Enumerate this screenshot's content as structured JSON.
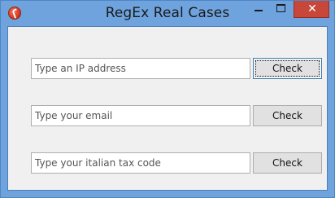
{
  "window": {
    "title": "RegEx Real Cases",
    "close_glyph": "✕"
  },
  "form": {
    "rows": [
      {
        "placeholder": "Type an IP address",
        "value": "",
        "button_label": "Check"
      },
      {
        "placeholder": "Type your email",
        "value": "",
        "button_label": "Check"
      },
      {
        "placeholder": "Type your italian tax code",
        "value": "",
        "button_label": "Check"
      }
    ]
  },
  "colors": {
    "title_bar": "#6fa3de",
    "close_button": "#c7483a",
    "client_background": "#f0f0f0"
  },
  "icons": {
    "app": "app-icon",
    "minimize": "minimize-icon",
    "maximize": "maximize-icon",
    "close": "close-icon"
  }
}
